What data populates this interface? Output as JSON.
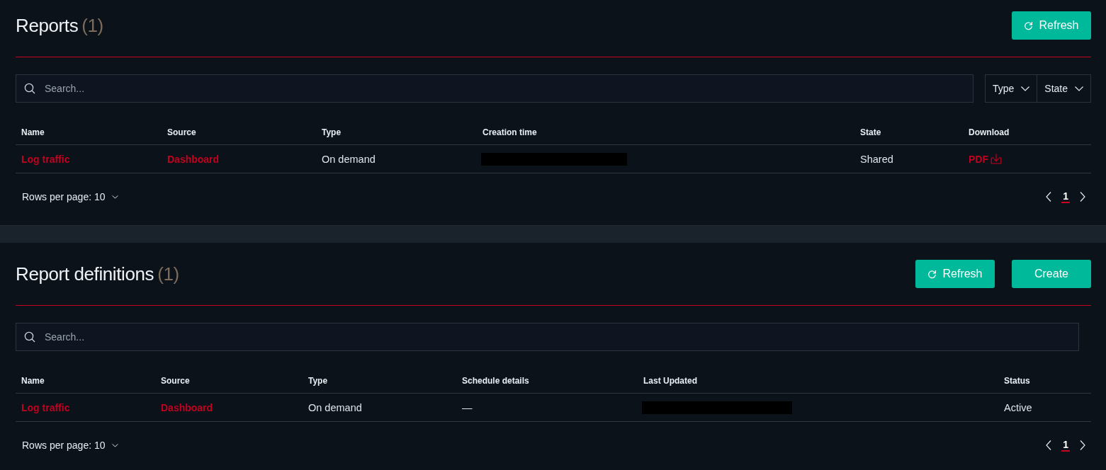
{
  "reports": {
    "title": "Reports",
    "count": "(1)",
    "buttons": [
      {
        "kind": "refresh",
        "label": "Refresh"
      }
    ],
    "search": {
      "placeholder": "Search..."
    },
    "filters": [
      {
        "label": "Type"
      },
      {
        "label": "State"
      }
    ],
    "table": {
      "columns": [
        "Name",
        "Source",
        "Type",
        "Creation time",
        "State",
        "Download"
      ],
      "rows": [
        {
          "cells": [
            {
              "kind": "link",
              "text": "Log traffic"
            },
            {
              "kind": "link",
              "text": "Dashboard"
            },
            {
              "kind": "text",
              "text": "On demand"
            },
            {
              "kind": "redacted"
            },
            {
              "kind": "text",
              "text": "Shared"
            },
            {
              "kind": "download",
              "text": "PDF"
            }
          ]
        }
      ]
    },
    "pagination": {
      "rows_per_page": "Rows per page: 10",
      "pages": [
        {
          "label": "1",
          "selected": true
        }
      ]
    }
  },
  "report_definitions": {
    "title": "Report definitions",
    "count": "(1)",
    "buttons": [
      {
        "kind": "refresh",
        "label": "Refresh"
      },
      {
        "kind": "create",
        "label": "Create"
      }
    ],
    "search": {
      "placeholder": "Search..."
    },
    "table": {
      "columns": [
        "Name",
        "Source",
        "Type",
        "Schedule details",
        "Last Updated",
        "Status"
      ],
      "rows": [
        {
          "cells": [
            {
              "kind": "link",
              "text": "Log traffic"
            },
            {
              "kind": "link",
              "text": "Dashboard"
            },
            {
              "kind": "text",
              "text": "On demand"
            },
            {
              "kind": "text",
              "text": "—"
            },
            {
              "kind": "redacted"
            },
            {
              "kind": "text",
              "text": "Active"
            }
          ]
        }
      ]
    },
    "pagination": {
      "rows_per_page": "Rows per page: 10",
      "pages": [
        {
          "label": "1",
          "selected": true
        }
      ]
    }
  }
}
